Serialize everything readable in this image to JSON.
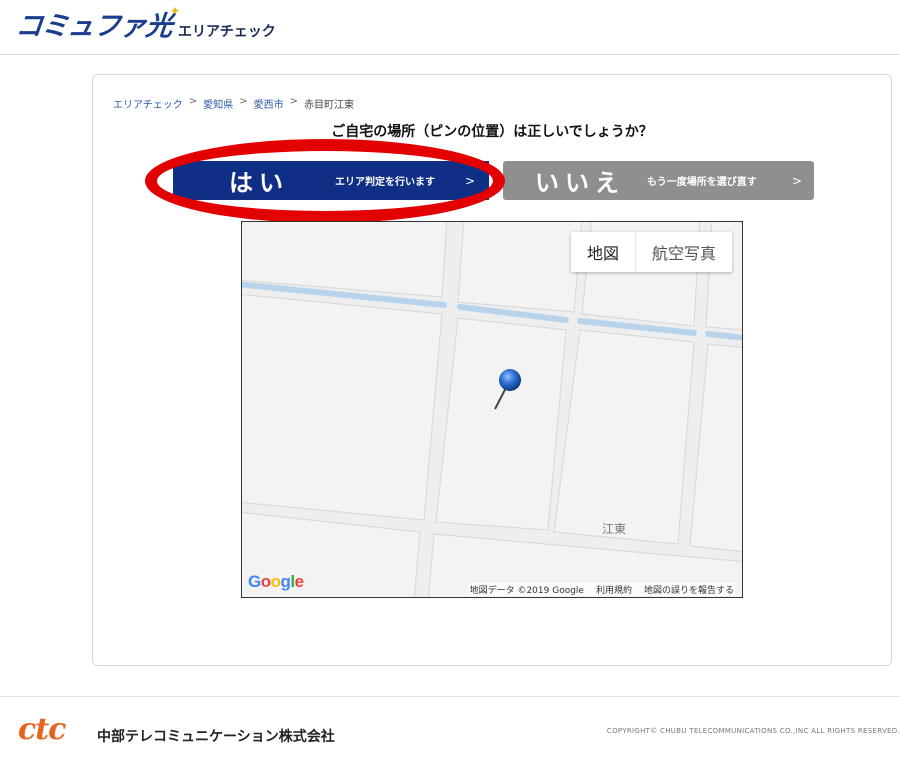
{
  "header": {
    "logo_text": "コミュファ光",
    "page_title": "エリアチェック"
  },
  "breadcrumb": {
    "items": [
      "エリアチェック",
      "愛知県",
      "愛西市"
    ],
    "current": "赤目町江東",
    "separator": ">"
  },
  "question": "ご自宅の場所（ピンの位置）は正しいでしょうか？",
  "buttons": {
    "yes": {
      "label": "はい",
      "sub_label": "エリア判定を行います",
      "chevron": ">"
    },
    "no": {
      "label": "いいえ",
      "sub_label": "もう一度場所を選び直す",
      "chevron": ">"
    }
  },
  "map": {
    "type_controls": {
      "map": "地図",
      "satellite": "航空写真"
    },
    "place_label": "江東",
    "google_logo": [
      "G",
      "o",
      "o",
      "g",
      "l",
      "e"
    ],
    "attribution": {
      "data": "地図データ ©2019 Google",
      "terms": "利用規約",
      "report": "地図の誤りを報告する"
    }
  },
  "footer": {
    "logo": "ctc",
    "company": "中部テレコミュニケーション株式会社",
    "copyright": "COPYRIGHT© CHUBU TELECOMMUNICATIONS CO.,INC ALL RIGHTS RESERVED."
  },
  "colors": {
    "brand_blue": "#0f2f86",
    "button_gray": "#8f8f8f",
    "highlight_red": "#e30000",
    "ctc_orange": "#e7641e",
    "map_water": "#b8d4ec",
    "pin_blue": "#2a6fcf"
  }
}
